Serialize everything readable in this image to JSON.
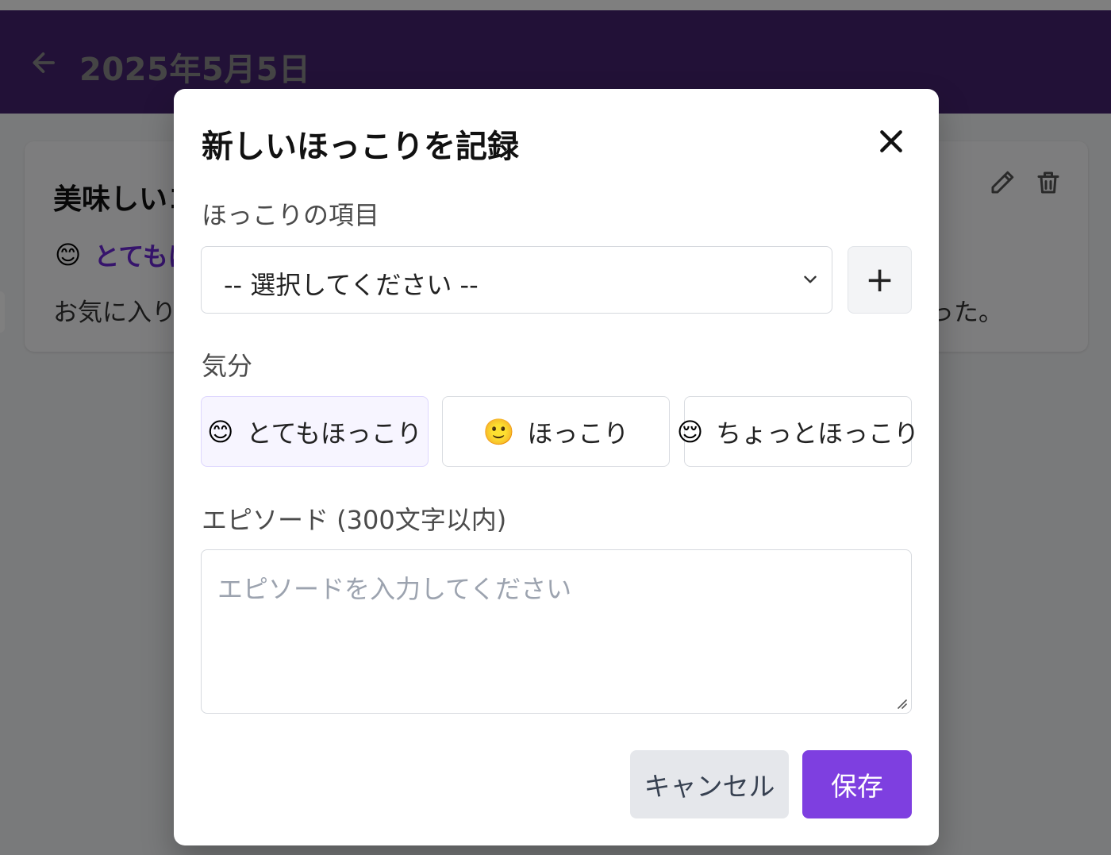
{
  "header": {
    "title": "2025年5月5日"
  },
  "entry": {
    "title": "美味しいコ",
    "mood_emoji": "😊",
    "mood_label": "とてもほ",
    "text_left": "お気に入りの",
    "text_right": "った。"
  },
  "modal": {
    "title": "新しいほっこりを記録",
    "item_label": "ほっこりの項目",
    "select_value": "-- 選択してください --",
    "add_symbol": "+",
    "mood_label": "気分",
    "moods": [
      {
        "emoji": "😊",
        "label": "とてもほっこり",
        "selected": true
      },
      {
        "emoji": "🙂",
        "label": "ほっこり",
        "selected": false
      },
      {
        "emoji": "😌",
        "label": "ちょっとほっこり",
        "selected": false
      }
    ],
    "episode_label": "エピソード (300文字以内)",
    "episode_placeholder": "エピソードを入力してください",
    "cancel_label": "キャンセル",
    "save_label": "保存"
  },
  "colors": {
    "header_bg": "#44226e",
    "accent": "#7e3fe0",
    "mood_text": "#6d28d9"
  }
}
